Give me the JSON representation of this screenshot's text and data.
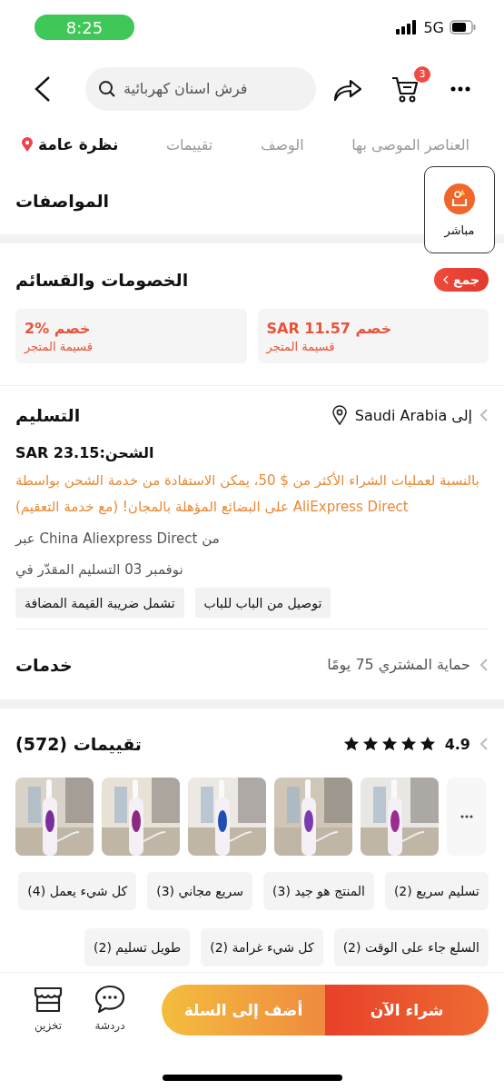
{
  "status_bar": {
    "time": "8:25",
    "network": "5G"
  },
  "top_bar": {
    "search": {
      "placeholder": "فرش اسنان كهربائية"
    },
    "cart_count": "3"
  },
  "tabs": [
    {
      "label": "العناصر الموصى بها",
      "selected": false
    },
    {
      "label": "الوصف",
      "selected": false
    },
    {
      "label": "تقييمات",
      "selected": false
    },
    {
      "label": "نظرة عامة",
      "selected": true
    }
  ],
  "live_button": {
    "label": "مباشر"
  },
  "specifications": {
    "title": "المواصفات"
  },
  "coupons": {
    "title": "الخصومات والقسائم",
    "collect_button": "جمع",
    "items": [
      {
        "value": "خصم SAR 11.57",
        "type": "قسيمة المتجر"
      },
      {
        "value": "خصم %2",
        "type": "قسيمة المتجر"
      }
    ]
  },
  "delivery": {
    "title": "التسليم",
    "destination": "إلى Saudi Arabia",
    "shipping": "الشحن:SAR 23.15",
    "promo": "بالنسبة لعمليات الشراء الأكثر من $ 50، يمكن الاستفادة من خدمة الشحن بواسطة AliExpress Direct على البضائع المؤهلة بالمجان! (مع خدمة التعقيم)",
    "route": "من China Aliexpress Direct عبر",
    "estimate": "نوفمبر 03 التسليم المقدّر في",
    "tags": [
      "توصيل من الباب للباب",
      "تشمل ضريبة القيمة المضافة"
    ]
  },
  "services": {
    "title": "خدمات",
    "summary": "حماية المشتري 75 يومًا"
  },
  "reviews": {
    "title": "تقييمات (572)",
    "rating": "4.9",
    "stars": 5,
    "photos": [
      {
        "kind": "picture"
      },
      {
        "kind": "picture"
      },
      {
        "kind": "picture"
      },
      {
        "kind": "picture"
      },
      {
        "kind": "picture"
      }
    ],
    "tags": [
      "تسليم سريع (2)",
      "المنتج هو جيد (3)",
      "سريع مجاني (3)",
      "كل شيء يعمل (4)",
      "السلع جاء على الوقت (2)",
      "كل شيء غرامة (2)",
      "طويل تسليم (2)"
    ]
  },
  "bottom_bar": {
    "actions": [
      {
        "label": "دردشة",
        "kind": "chat"
      },
      {
        "label": "تخزين",
        "kind": "store"
      }
    ],
    "add_to_cart": "أضف إلى السلة",
    "buy_now": "شراء الآن"
  }
}
